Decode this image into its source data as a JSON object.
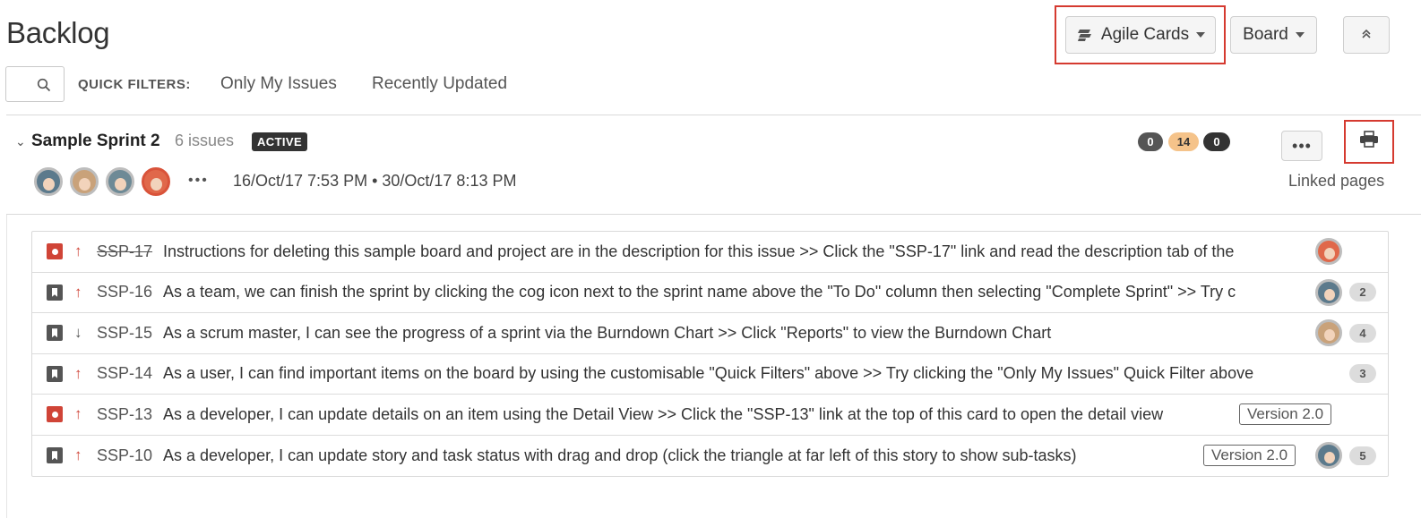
{
  "header": {
    "title": "Backlog",
    "agile_cards_label": "Agile Cards",
    "board_label": "Board"
  },
  "filters": {
    "label": "QUICK FILTERS:",
    "items": [
      "Only My Issues",
      "Recently Updated"
    ]
  },
  "sprint": {
    "name": "Sample Sprint 2",
    "issue_count": "6 issues",
    "status": "ACTIVE",
    "counts": {
      "todo": "0",
      "in_progress": "14",
      "done": "0"
    },
    "more_label": "•••",
    "avatars_more": "•••",
    "dates": "16/Oct/17 7:53 PM • 30/Oct/17 8:13 PM",
    "linked_pages": "Linked pages"
  },
  "issues": [
    {
      "type": "bug",
      "priority": "up",
      "key": "SSP-17",
      "done": true,
      "summary": "Instructions for deleting this sample board and project are in the description for this issue >> Click the \"SSP-17\" link and read the description tab of the",
      "version": "",
      "estimate": ""
    },
    {
      "type": "story",
      "priority": "up",
      "key": "SSP-16",
      "done": false,
      "summary": "As a team, we can finish the sprint by clicking the cog icon next to the sprint name above the \"To Do\" column then selecting \"Complete Sprint\" >> Try c",
      "version": "",
      "estimate": "2"
    },
    {
      "type": "story",
      "priority": "down",
      "key": "SSP-15",
      "done": false,
      "summary": "As a scrum master, I can see the progress of a sprint via the Burndown Chart >> Click \"Reports\" to view the Burndown Chart",
      "version": "",
      "estimate": "4"
    },
    {
      "type": "story",
      "priority": "up",
      "key": "SSP-14",
      "done": false,
      "summary": "As a user, I can find important items on the board by using the customisable \"Quick Filters\" above >> Try clicking the \"Only My Issues\" Quick Filter above",
      "version": "",
      "estimate": "3"
    },
    {
      "type": "bug",
      "priority": "up",
      "key": "SSP-13",
      "done": false,
      "summary": "As a developer, I can update details on an item using the Detail View >> Click the \"SSP-13\" link at the top of this card to open the detail view",
      "version": "Version 2.0",
      "estimate": ""
    },
    {
      "type": "story",
      "priority": "up",
      "key": "SSP-10",
      "done": false,
      "summary": "As a developer, I can update story and task status with drag and drop (click the triangle at far left of this story to show sub-tasks)",
      "version": "Version 2.0",
      "estimate": "5"
    }
  ],
  "glyphs": {
    "priority_up": "↑",
    "priority_down": "↓",
    "chevron": "⌄"
  },
  "colors": {
    "highlight": "#d53a30",
    "bug": "#d04437",
    "in_progress": "#f5c38a"
  }
}
